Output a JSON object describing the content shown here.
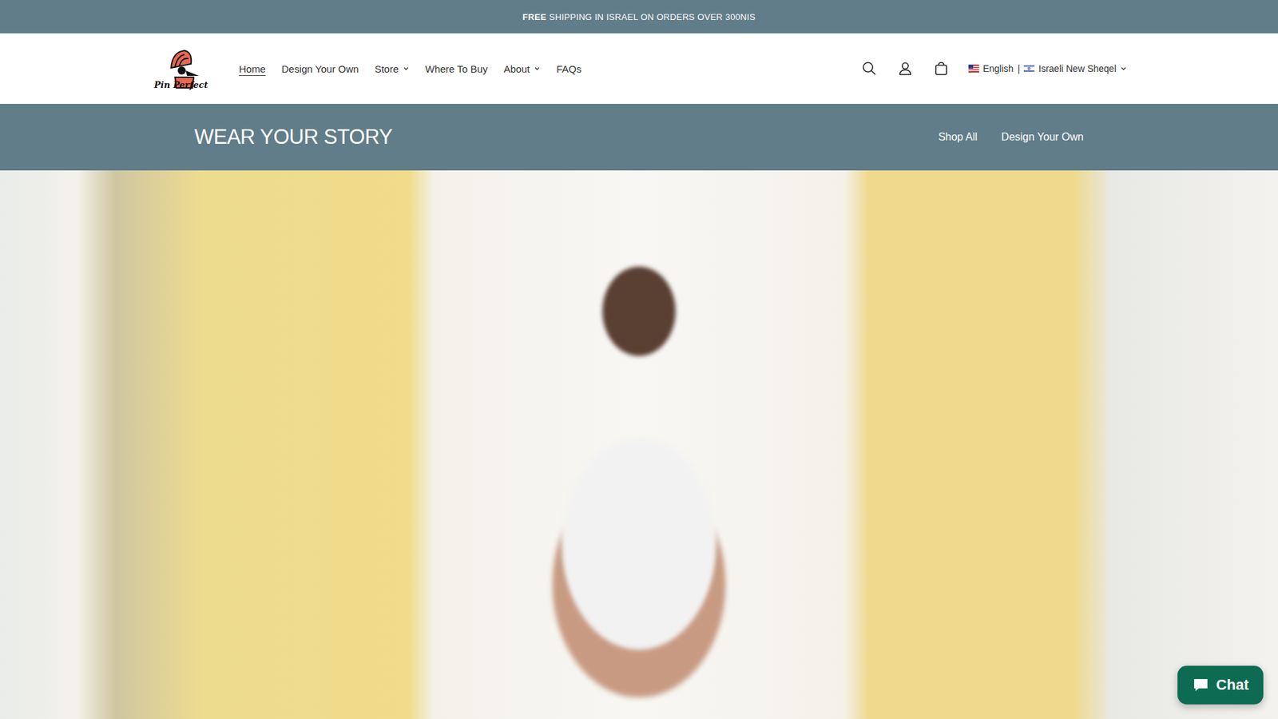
{
  "announcement": {
    "bold": "FREE",
    "text": "SHIPPING IN ISRAEL ON ORDERS OVER 300NIS"
  },
  "logo": {
    "text": "Pin Perfect"
  },
  "nav": [
    {
      "label": "Home",
      "selected": true,
      "dropdown": false
    },
    {
      "label": "Design Your Own",
      "selected": false,
      "dropdown": false
    },
    {
      "label": "Store",
      "selected": false,
      "dropdown": true
    },
    {
      "label": "Where To Buy",
      "selected": false,
      "dropdown": false
    },
    {
      "label": "About",
      "selected": false,
      "dropdown": true
    },
    {
      "label": "FAQs",
      "selected": false,
      "dropdown": false
    }
  ],
  "localization": {
    "language": "English",
    "separator": "|",
    "currency": "Israeli New Sheqel"
  },
  "banner": {
    "title": "WEAR YOUR STORY",
    "links": [
      "Shop All",
      "Design Your Own"
    ]
  },
  "chat": {
    "label": "Chat"
  }
}
